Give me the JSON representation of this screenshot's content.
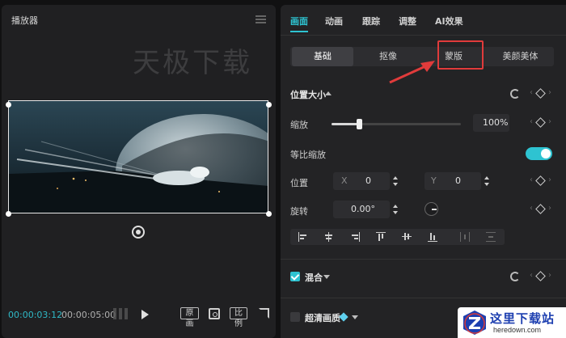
{
  "player": {
    "title": "播放器",
    "watermark": "天极下载",
    "current_time": "00:00:03:12",
    "total_time": "00:00:05:00",
    "btn_original": "原画",
    "btn_ratio": "比例"
  },
  "props": {
    "tabs": [
      "画面",
      "动画",
      "跟踪",
      "调整",
      "AI效果"
    ],
    "active_tab": "画面",
    "sub_tabs": [
      "基础",
      "抠像",
      "蒙版",
      "美颜美体"
    ],
    "active_sub_tab": "基础",
    "position_size": {
      "title": "位置大小",
      "scale_label": "缩放",
      "scale_value": "100%",
      "scale_fraction": 0.21,
      "uniform_scale_label": "等比缩放",
      "uniform_scale_on": true,
      "position_label": "位置",
      "x_label": "X",
      "x_value": "0",
      "y_label": "Y",
      "y_value": "0",
      "rotate_label": "旋转",
      "rotate_value": "0.00°"
    },
    "blend": {
      "label": "混合",
      "checked": true
    },
    "ultra_hd": {
      "label": "超清画质",
      "checked": false
    }
  },
  "site_badge": {
    "title": "这里下载站",
    "url": "heredown.com"
  },
  "colors": {
    "accent": "#2ec3d1",
    "highlight_box": "#e03b3b",
    "panel_bg": "#232325"
  }
}
